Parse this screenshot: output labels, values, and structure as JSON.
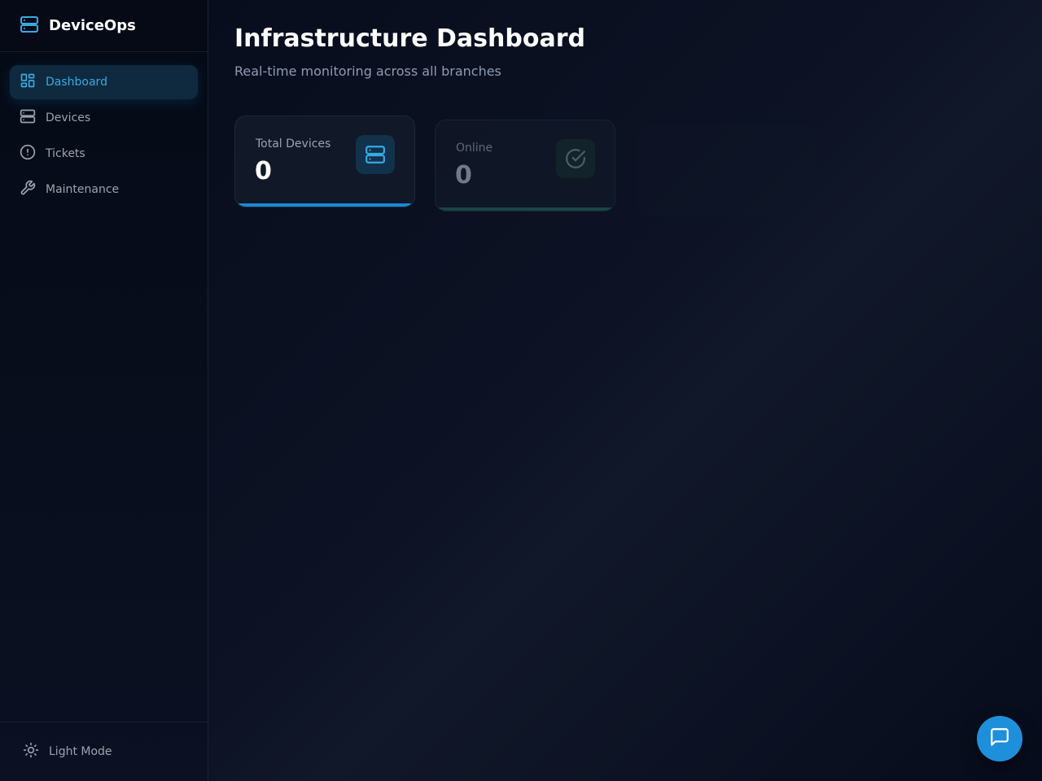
{
  "app": {
    "name": "DeviceOps",
    "icon": "server-icon"
  },
  "sidebar": {
    "items": [
      {
        "label": "Dashboard",
        "icon": "grid-icon",
        "active": true
      },
      {
        "label": "Devices",
        "icon": "server-icon",
        "active": false
      },
      {
        "label": "Tickets",
        "icon": "alert-circle-icon",
        "active": false
      },
      {
        "label": "Maintenance",
        "icon": "wrench-icon",
        "active": false
      }
    ],
    "theme_toggle": {
      "label": "Light Mode",
      "icon": "sun-icon"
    }
  },
  "header": {
    "title": "Infrastructure Dashboard",
    "subtitle": "Real-time monitoring across all branches"
  },
  "stats": [
    {
      "label": "Total Devices",
      "value": "0",
      "icon": "server-icon",
      "accent": "#1a8ad4"
    },
    {
      "label": "Online",
      "value": "0",
      "icon": "check-circle-icon",
      "accent": "#1f5a55"
    }
  ],
  "chat": {
    "icon": "chat-icon"
  },
  "colors": {
    "accent": "#38a9e6",
    "button": "#1e90db",
    "background": "#0a0f1e",
    "sidebar": "#050a16"
  }
}
